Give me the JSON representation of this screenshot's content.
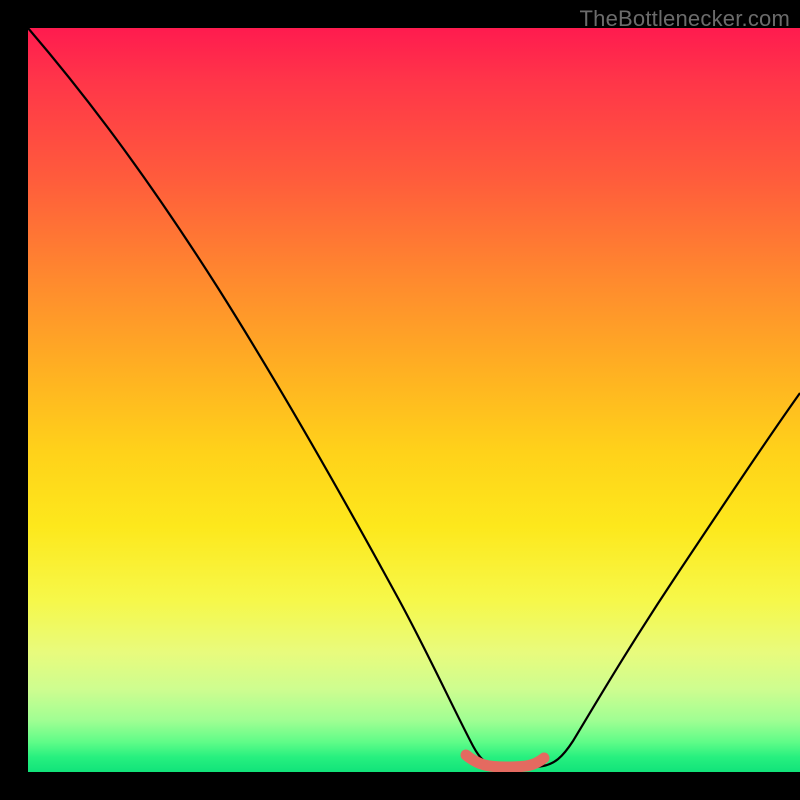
{
  "watermark": "TheBottlenecker.com",
  "chart_data": {
    "type": "line",
    "title": "",
    "xlabel": "",
    "ylabel": "",
    "xlim": [
      0,
      100
    ],
    "ylim": [
      0,
      100
    ],
    "series": [
      {
        "name": "curve",
        "x": [
          0,
          10,
          20,
          30,
          40,
          50,
          55,
          58,
          62,
          64,
          68,
          72,
          80,
          90,
          100
        ],
        "y": [
          100,
          87,
          74,
          60,
          44,
          26,
          13,
          3,
          0.5,
          0.5,
          3,
          9,
          22,
          38,
          55
        ]
      }
    ],
    "highlight": {
      "name": "bottom-segment",
      "x": [
        56.5,
        66.5
      ],
      "y": [
        2.0,
        2.0
      ]
    },
    "background_gradient": {
      "top_color": "#ff1b4f",
      "bottom_color": "#11e37a"
    }
  }
}
